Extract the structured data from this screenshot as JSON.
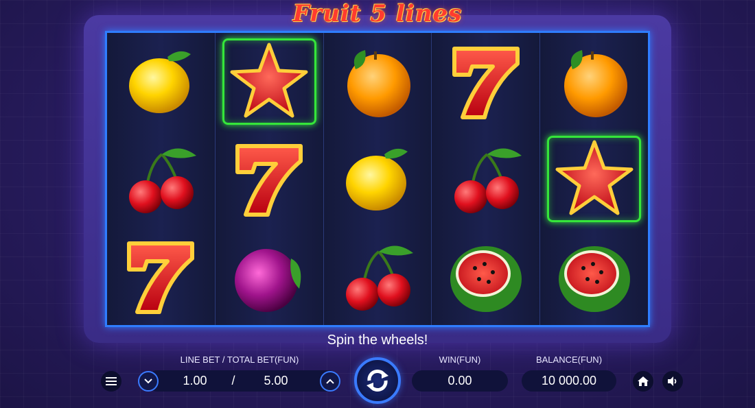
{
  "game": {
    "title": "Fruit 5 lines"
  },
  "message": "Spin the wheels!",
  "controls": {
    "bet_label": "LINE BET / TOTAL BET(FUN)",
    "line_bet": "1.00",
    "separator": "/",
    "total_bet": "5.00",
    "win_label": "WIN(FUN)",
    "win_value": "0.00",
    "balance_label": "BALANCE(FUN)",
    "balance_value": "10 000.00"
  },
  "reels": [
    [
      "lemon",
      "cherry",
      "seven"
    ],
    [
      "star",
      "seven",
      "plum"
    ],
    [
      "orange",
      "lemon",
      "cherry"
    ],
    [
      "seven",
      "cherry",
      "watermelon"
    ],
    [
      "orange",
      "star",
      "watermelon"
    ]
  ],
  "highlighted_cells": [
    [
      1,
      0
    ],
    [
      4,
      1
    ]
  ],
  "icons": {
    "menu": "menu-icon",
    "bet_decrease": "chevron-down-icon",
    "bet_increase": "chevron-up-icon",
    "spin": "spin-arrows-icon",
    "home": "home-icon",
    "sound": "speaker-icon"
  },
  "colors": {
    "reel_border": "#2f7dff",
    "win_highlight": "#35e63a",
    "logo": "#ff3b2f"
  }
}
